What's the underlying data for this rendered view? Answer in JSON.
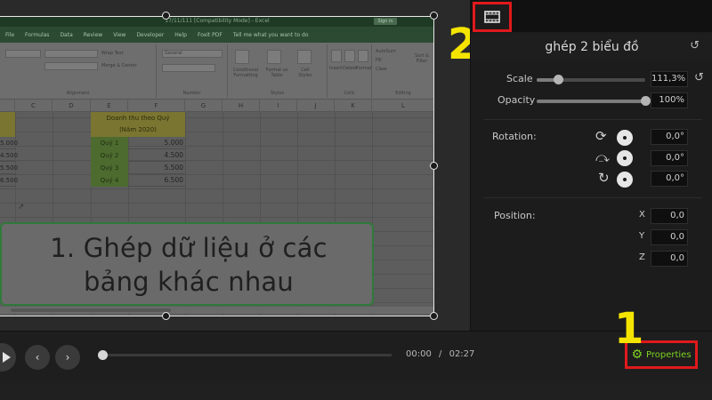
{
  "excel": {
    "title_bar": "17/11/111  [Compatibility Mode]  -  Excel",
    "sign_in": "Sign in",
    "menu": [
      "File",
      "Formulas",
      "Data",
      "Review",
      "View",
      "Developer",
      "Help",
      "Foxit PDF",
      "Tell me what you want to do"
    ],
    "ribbon": {
      "wrap_text": "Wrap Text",
      "merge_center": "Merge & Center",
      "number_format": "General",
      "conditional": "Conditional Formatting",
      "format_as_table": "Format as Table",
      "cell_styles": "Cell Styles",
      "insert": "Insert",
      "delete": "Delete",
      "format": "Format",
      "autosum": "AutoSum",
      "fill": "Fill",
      "clear": "Clear",
      "sort_filter": "Sort & Filter",
      "group_alignment": "Alignment",
      "group_number": "Number",
      "group_styles": "Styles",
      "group_cells": "Cells",
      "group_editing": "Editing"
    },
    "columns": [
      "C",
      "D",
      "E",
      "F",
      "G",
      "H",
      "I",
      "J",
      "K",
      "L"
    ],
    "left_col_values": [
      "5.000",
      "4.500",
      "5.500",
      "6.500"
    ],
    "table": {
      "header_line1": "Doanh thu theo Quý",
      "header_line2": "(Năm 2020)",
      "rows": [
        {
          "label": "Quý 1",
          "value": "5.000"
        },
        {
          "label": "Quý 2",
          "value": "4.500"
        },
        {
          "label": "Quý 3",
          "value": "5.500"
        },
        {
          "label": "Quý 4",
          "value": "6.500"
        }
      ]
    }
  },
  "caption": {
    "line1": "1. Ghép dữ liệu ở các",
    "line2": "bảng khác nhau"
  },
  "panel": {
    "title": "ghép 2 biểu đồ",
    "scale_label": "Scale",
    "scale_value": "111,3%",
    "scale_level": 0.2,
    "opacity_label": "Opacity",
    "opacity_value": "100%",
    "opacity_level": 1.0,
    "rotation_label": "Rotation:",
    "rotation": {
      "z": "0,0°",
      "y": "0,0°",
      "x": "0,0°"
    },
    "position_label": "Position:",
    "position": {
      "x": "0,0",
      "y": "0,0",
      "z": "0,0"
    },
    "axis_x": "X",
    "axis_y": "Y",
    "axis_z": "Z"
  },
  "transport": {
    "current_time": "00:00",
    "separator": "/",
    "total_time": "02:27",
    "properties_label": "Properties"
  },
  "annotations": {
    "one": "1",
    "two": "2"
  },
  "colors": {
    "highlight": "#e0191c",
    "accent_green": "#7ed321",
    "annotation_yellow": "#f5e400"
  }
}
